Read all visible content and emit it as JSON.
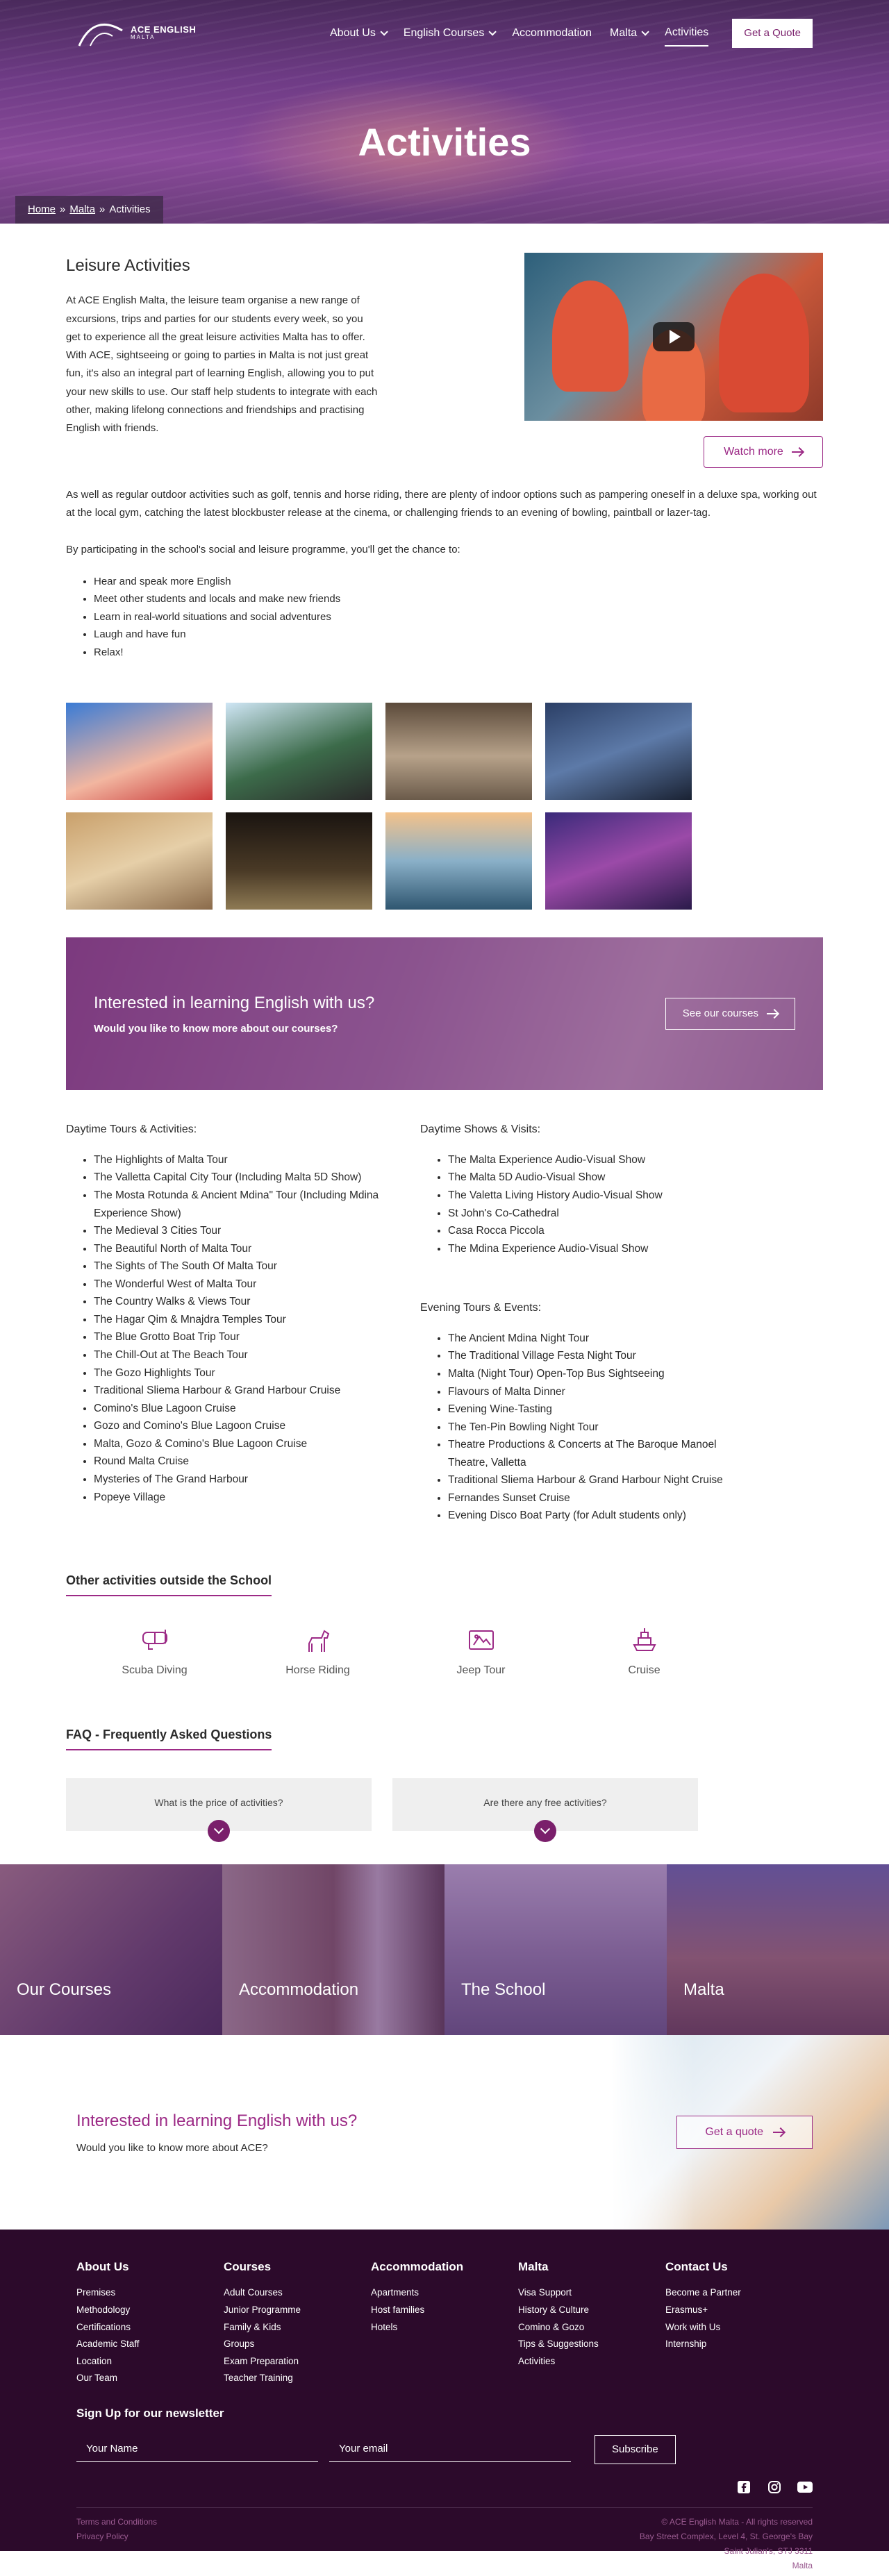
{
  "header": {
    "logo_line1": "ACE ENGLISH",
    "logo_line2": "MALTA",
    "nav": [
      {
        "label": "About Us",
        "dropdown": true
      },
      {
        "label": "English Courses",
        "dropdown": true
      },
      {
        "label": "Accommodation",
        "dropdown": false
      },
      {
        "label": "Malta",
        "dropdown": true
      },
      {
        "label": "Activities",
        "dropdown": false
      }
    ],
    "quote_label": "Get a Quote"
  },
  "hero": {
    "title": "Activities",
    "breadcrumb": [
      "Home",
      "Malta",
      "Activities"
    ],
    "separator": "»"
  },
  "intro": {
    "title": "Leisure Activities",
    "text": "At ACE English Malta, the leisure team organise a new range of excursions, trips and parties for our students every week, so you get to experience all the great leisure activities Malta has to offer. With ACE, sightseeing or going to parties in Malta is not just great fun, it's also an integral part of learning English, allowing you to put your new skills to use. Our staff help students to integrate with each other, making lifelong connections and friendships and practising English with friends.",
    "watch_label": "Watch more"
  },
  "body": {
    "para1": "As well as regular outdoor activities such as golf, tennis and horse riding, there are plenty of indoor options such as pampering oneself in a deluxe spa, working out at the local gym, catching the latest blockbuster release at the cinema, or challenging friends to an evening of bowling, paintball or lazer-tag.",
    "para2": "By participating in the school's social and leisure programme, you'll get the chance to:",
    "bullets": [
      "Hear and speak more English",
      "Meet other students and locals and make new friends",
      "Learn in real-world situations and social adventures",
      "Laugh and have fun",
      "Relax!"
    ]
  },
  "banner": {
    "title": "Interested in learning English with us?",
    "subtitle": "Would you like to know more about our courses?",
    "button": "See our courses"
  },
  "lists": {
    "daytime_title": "Daytime Tours & Activities:",
    "daytime": [
      "The Highlights of Malta Tour",
      "The Valletta Capital City Tour (Including Malta 5D Show)",
      "The Mosta Rotunda & Ancient Mdina\" Tour (Including Mdina Experience Show)",
      "The Medieval 3 Cities Tour",
      "The Beautiful North of Malta Tour",
      "The Sights of The South Of Malta Tour",
      "The Wonderful West of Malta Tour",
      "The Country Walks & Views Tour",
      "The Hagar Qim & Mnajdra Temples Tour",
      "The Blue Grotto Boat Trip Tour",
      "The Chill-Out at The Beach Tour",
      "The Gozo Highlights Tour",
      "Traditional Sliema Harbour & Grand Harbour Cruise",
      "Comino's Blue Lagoon Cruise",
      "Gozo and Comino's Blue Lagoon Cruise",
      "Malta, Gozo & Comino's Blue Lagoon Cruise",
      "Round Malta Cruise",
      "Mysteries of The Grand Harbour",
      "Popeye Village"
    ],
    "shows_title": "Daytime Shows & Visits:",
    "shows": [
      "The Malta Experience Audio-Visual Show",
      "The Malta 5D Audio-Visual Show",
      "The Valetta Living History Audio-Visual Show",
      "St John's Co-Cathedral",
      "Casa Rocca Piccola",
      "The Mdina Experience Audio-Visual Show"
    ],
    "evening_title": "Evening Tours & Events:",
    "evening": [
      "The Ancient Mdina Night Tour",
      "The Traditional Village Festa Night Tour",
      "Malta (Night Tour) Open-Top Bus Sightseeing",
      "Flavours of Malta Dinner",
      "Evening Wine-Tasting",
      "The Ten-Pin Bowling Night Tour",
      "Theatre Productions & Concerts at The Baroque Manoel Theatre, Valletta",
      "Traditional Sliema Harbour & Grand Harbour Night Cruise",
      "Fernandes Sunset Cruise",
      "Evening Disco Boat Party (for Adult students only)"
    ]
  },
  "other": {
    "title": "Other activities outside the School",
    "items": [
      {
        "label": "Scuba Diving",
        "icon": "scuba-mask-icon"
      },
      {
        "label": "Horse Riding",
        "icon": "horse-icon"
      },
      {
        "label": "Jeep Tour",
        "icon": "jeep-icon"
      },
      {
        "label": "Cruise",
        "icon": "ship-icon"
      }
    ]
  },
  "faq": {
    "title": "FAQ - Frequently Asked Questions",
    "questions": [
      "What is the price of activities?",
      "Are there any free activities?"
    ]
  },
  "tiles": [
    "Our Courses",
    "Accommodation",
    "The School",
    "Malta"
  ],
  "cta": {
    "title": "Interested in learning English with us?",
    "subtitle": "Would you like to know more about ACE?",
    "button": "Get a quote"
  },
  "footer": {
    "cols": [
      {
        "title": "About Us",
        "items": [
          "Premises",
          "Methodology",
          "Certifications",
          "Academic Staff",
          "Location",
          "Our Team"
        ]
      },
      {
        "title": "Courses",
        "items": [
          "Adult Courses",
          "Junior Programme",
          "Family & Kids",
          "Groups",
          "Exam Preparation",
          "Teacher Training"
        ]
      },
      {
        "title": "Accommodation",
        "items": [
          "Apartments",
          "Host families",
          "Hotels"
        ]
      },
      {
        "title": "Malta",
        "items": [
          "Visa Support",
          "History & Culture",
          "Comino & Gozo",
          "Tips & Suggestions",
          "Activities"
        ]
      },
      {
        "title": "Contact Us",
        "items": [
          "Become a Partner",
          "Erasmus+",
          "Work with Us",
          "Internship"
        ]
      }
    ],
    "newsletter_title": "Sign Up for our newsletter",
    "name_placeholder": "Your Name",
    "email_placeholder": "Your email",
    "subscribe": "Subscribe",
    "legal": [
      "Terms and Conditions",
      "Privacy Policy"
    ],
    "copyright": "© ACE English Malta - All rights reserved",
    "address": [
      "Bay Street Complex, Level 4, St. George's Bay",
      "Saint Julian's, STJ 3311",
      "Malta"
    ],
    "socials": [
      "facebook-icon",
      "instagram-icon",
      "youtube-icon"
    ]
  },
  "colors": {
    "brand": "#9c2a86",
    "footer_bg": "#2c0a2b",
    "hero_overlay": "#6e3b85"
  }
}
